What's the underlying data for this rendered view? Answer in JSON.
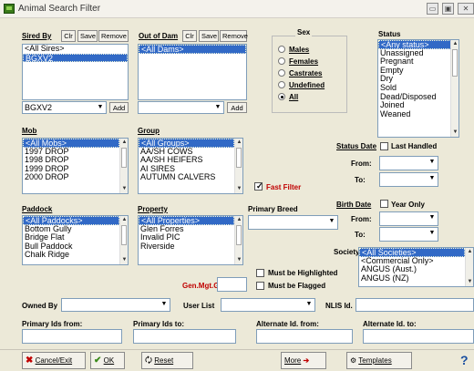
{
  "title": "Animal Search Filter",
  "window_controls": {
    "minimize": "▭",
    "maximize": "▣",
    "close": "✕"
  },
  "sired_by": {
    "label": "Sired By",
    "clr": "Clr",
    "save": "Save",
    "remove": "Remove",
    "items": [
      "<All Sires>",
      "BGXV2"
    ],
    "selected": 1,
    "field_value": "BGXV2",
    "add": "Add"
  },
  "out_of_dam": {
    "label": "Out of Dam",
    "clr": "Clr",
    "save": "Save",
    "remove": "Remove",
    "items": [
      "<All Dams>"
    ],
    "selected": 0,
    "field_value": "",
    "add": "Add"
  },
  "sex": {
    "label": "Sex",
    "options": [
      "Males",
      "Females",
      "Castrates",
      "Undefined",
      "All"
    ],
    "selected": 4
  },
  "status": {
    "label": "Status",
    "items": [
      "<Any status>",
      "Unassigned",
      "Pregnant",
      "Empty",
      "Dry",
      "Sold",
      "Dead/Disposed",
      "Joined",
      "Weaned"
    ],
    "selected": 0
  },
  "mob": {
    "label": "Mob",
    "items": [
      "<All Mobs>",
      "1997 DROP",
      "1998 DROP",
      "1999 DROP",
      "2000 DROP"
    ],
    "selected": 0
  },
  "group": {
    "label": "Group",
    "items": [
      "<All Groups>",
      "AA/SH COWS",
      "AA/SH HEIFERS",
      "AI SIRES",
      "AUTUMN CALVERS"
    ],
    "selected": 0
  },
  "fast_filter": {
    "label": "Fast Filter",
    "checked": true
  },
  "status_date": {
    "label": "Status Date",
    "last_handled": "Last Handled",
    "from": "From:",
    "to": "To:"
  },
  "birth_date": {
    "label": "Birth Date",
    "year_only": "Year Only",
    "from": "From:",
    "to": "To:"
  },
  "paddock": {
    "label": "Paddock",
    "items": [
      "<All Paddocks>",
      "Bottom Gully",
      "Bridge Flat",
      "Bull Paddock",
      "Chalk Ridge"
    ],
    "selected": 0
  },
  "property": {
    "label": "Property",
    "items": [
      "<All Properties>",
      "Glen Forres",
      "Invalid PIC",
      "Riverside"
    ],
    "selected": 0
  },
  "primary_breed": {
    "label": "Primary Breed",
    "value": ""
  },
  "society": {
    "label": "Society",
    "items": [
      "<All Societies>",
      "<Commercial Only>",
      "ANGUS (Aust.)",
      "ANGUS (NZ)"
    ],
    "selected": 0
  },
  "gen_mgt_grp": {
    "label": "Gen.Mgt.Grp.",
    "value": ""
  },
  "must_be_highlighted": "Must be Highlighted",
  "must_be_flagged": "Must be Flagged",
  "owned_by": {
    "label": "Owned By",
    "value": ""
  },
  "user_list": {
    "label": "User List",
    "value": ""
  },
  "nlis_id": {
    "label": "NLIS Id.",
    "value": ""
  },
  "primary_ids_from": {
    "label": "Primary Ids from:",
    "value": ""
  },
  "primary_ids_to": {
    "label": "Primary Ids to:",
    "value": ""
  },
  "alt_id_from": {
    "label": "Alternate Id. from:",
    "value": ""
  },
  "alt_id_to": {
    "label": "Alternate Id. to:",
    "value": ""
  },
  "buttons": {
    "cancel": "Cancel/Exit",
    "ok": "OK",
    "reset": "Reset",
    "more": "More",
    "templates": "Templates",
    "help": "?"
  },
  "colors": {
    "selection": "#3169c6",
    "accent_red": "#c00000",
    "window_bg": "#ece9d8"
  }
}
